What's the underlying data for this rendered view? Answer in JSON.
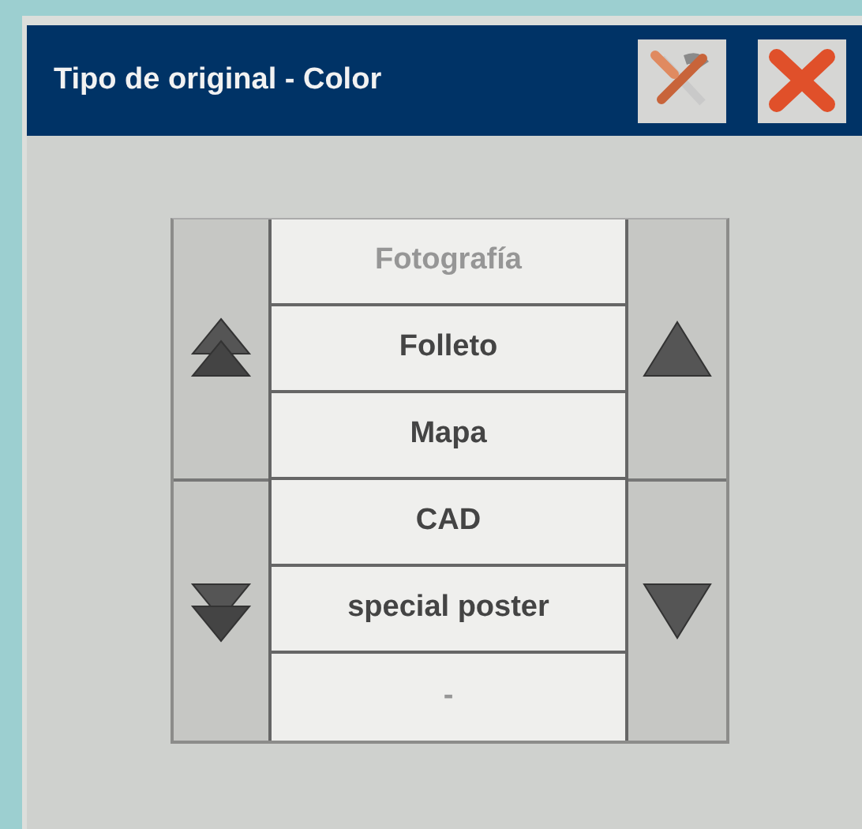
{
  "window": {
    "title": "Tipo de original - Color"
  },
  "options": [
    {
      "label": "Fotografía",
      "disabled": true
    },
    {
      "label": "Folleto",
      "disabled": false
    },
    {
      "label": "Mapa",
      "disabled": false
    },
    {
      "label": "CAD",
      "disabled": false
    },
    {
      "label": "special poster",
      "disabled": false
    },
    {
      "label": "-",
      "disabled": true
    }
  ]
}
